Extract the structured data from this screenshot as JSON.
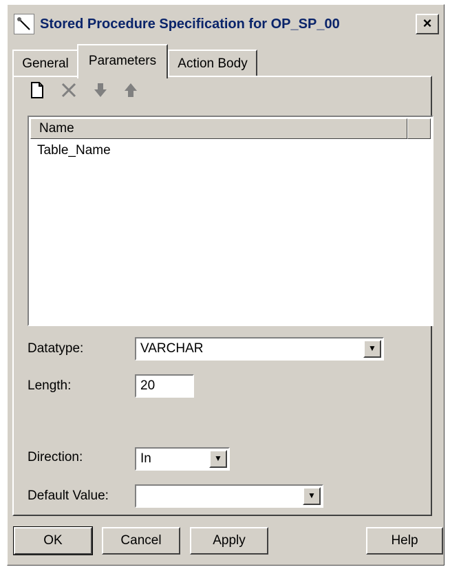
{
  "window": {
    "title": "Stored Procedure Specification for OP_SP_00",
    "close": "×"
  },
  "tabs": [
    {
      "label": "General",
      "active": false
    },
    {
      "label": "Parameters",
      "active": true
    },
    {
      "label": "Action Body",
      "active": false
    }
  ],
  "toolbar": {
    "new_icon": "new-document-icon",
    "delete_icon": "delete-icon",
    "down_icon": "move-down-icon",
    "up_icon": "move-up-icon"
  },
  "list": {
    "header": "Name",
    "rows": [
      "Table_Name"
    ]
  },
  "form": {
    "datatype_label": "Datatype:",
    "datatype_value": "VARCHAR",
    "length_label": "Length:",
    "length_value": "20",
    "direction_label": "Direction:",
    "direction_value": "In",
    "default_label": "Default Value:",
    "default_value": ""
  },
  "buttons": {
    "ok": "OK",
    "cancel": "Cancel",
    "apply": "Apply",
    "help": "Help"
  },
  "colors": {
    "face": "#d4d0c8",
    "title_text": "#0a246a"
  }
}
